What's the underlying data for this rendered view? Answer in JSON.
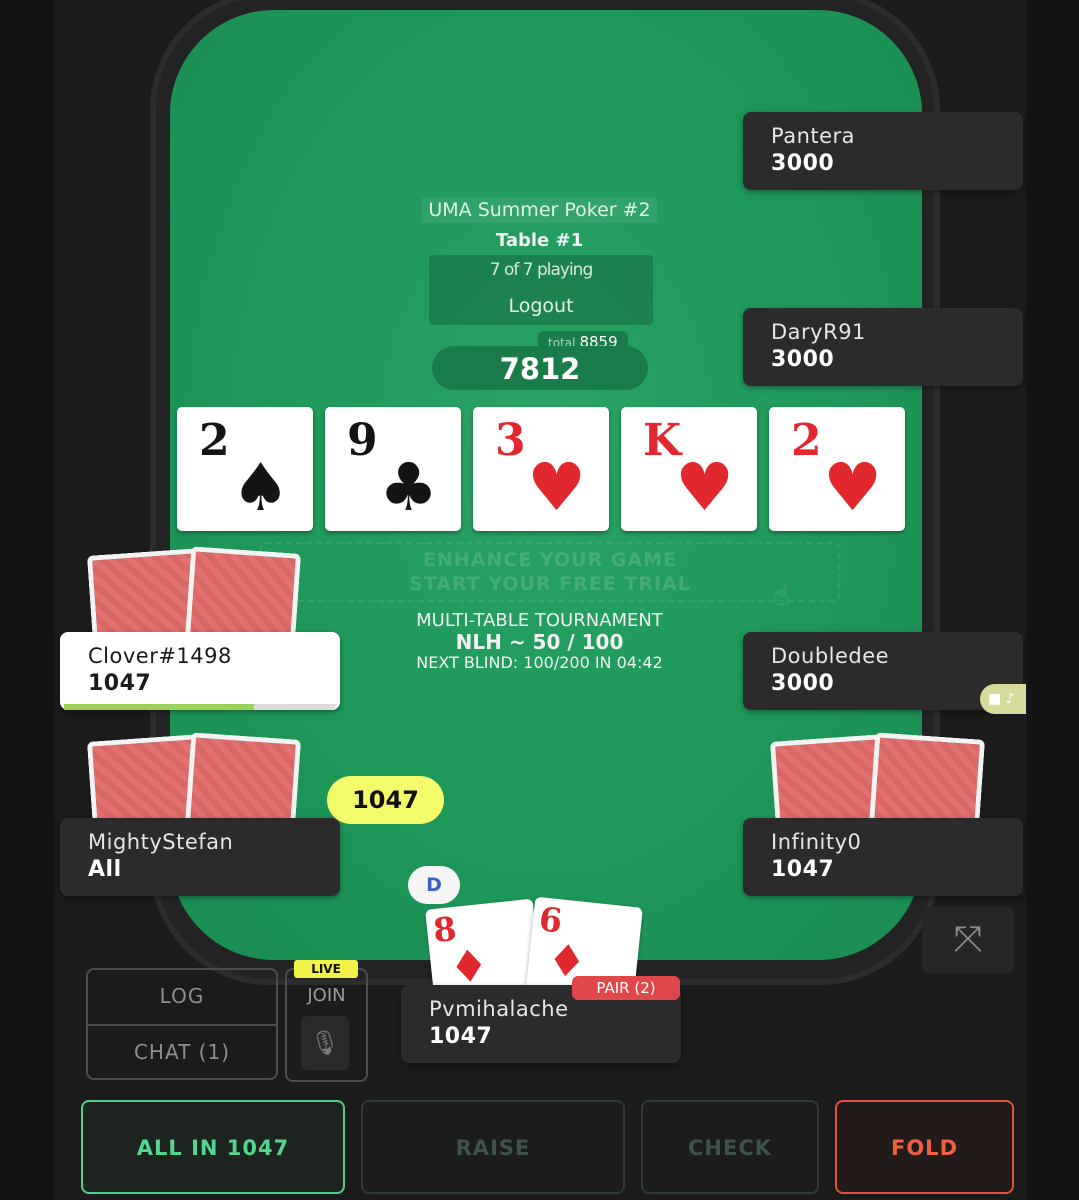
{
  "table": {
    "tournament_name": "UMA Summer Poker #2",
    "table_name": "Table #1",
    "players_playing": "7 of 7 playing",
    "logout_label": "Logout"
  },
  "pot": {
    "total_label": "total",
    "total": "8859",
    "main": "7812"
  },
  "board": [
    {
      "rank": "2",
      "suit": "♠",
      "color": "black"
    },
    {
      "rank": "9",
      "suit": "♣",
      "color": "black"
    },
    {
      "rank": "3",
      "suit": "♥",
      "color": "red"
    },
    {
      "rank": "K",
      "suit": "♥",
      "color": "red"
    },
    {
      "rank": "2",
      "suit": "♥",
      "color": "red"
    }
  ],
  "promo": {
    "line1": "ENHANCE YOUR GAME",
    "line2": "START YOUR FREE TRIAL",
    "icon": "hand-pointer-icon"
  },
  "tournament_info": {
    "type": "MULTI-TABLE TOURNAMENT",
    "blinds": "NLH ~ 50 / 100",
    "next_blind": "NEXT BLIND: 100/200 IN 04:42"
  },
  "seats": {
    "pantera": {
      "name": "Pantera",
      "stack": "3000"
    },
    "daryr91": {
      "name": "DaryR91",
      "stack": "3000"
    },
    "clover": {
      "name": "Clover#1498",
      "stack": "1047",
      "timer_fraction": 0.7
    },
    "doubledee": {
      "name": "Doubledee",
      "stack": "3000"
    },
    "mightystefan": {
      "name": "MightyStefan",
      "stack": "All"
    },
    "infinity0": {
      "name": "Infinity0",
      "stack": "1047"
    },
    "hero": {
      "name": "Pvmihalache",
      "stack": "1047",
      "hand_badge": "PAIR (2)"
    }
  },
  "bet_chip": "1047",
  "dealer_button": "D",
  "hero_cards": [
    {
      "rank": "8",
      "suit": "♦"
    },
    {
      "rank": "6",
      "suit": "♦"
    }
  ],
  "controls": {
    "log": "LOG",
    "chat": "CHAT (1)",
    "live": "LIVE",
    "join": "JOIN",
    "expand_icon": "expand-arrows-icon",
    "mic_icon": "microphone-icon",
    "camera_icon": "video-camera-icon"
  },
  "actions": {
    "all_in": "ALL IN 1047",
    "raise": "RAISE",
    "check": "CHECK",
    "fold": "FOLD"
  },
  "colors": {
    "felt": "#1f9a5a",
    "all_in": "#55d68f",
    "fold": "#f0603f",
    "bet_chip": "#f4fb6a",
    "hand_badge": "#e0474a"
  }
}
